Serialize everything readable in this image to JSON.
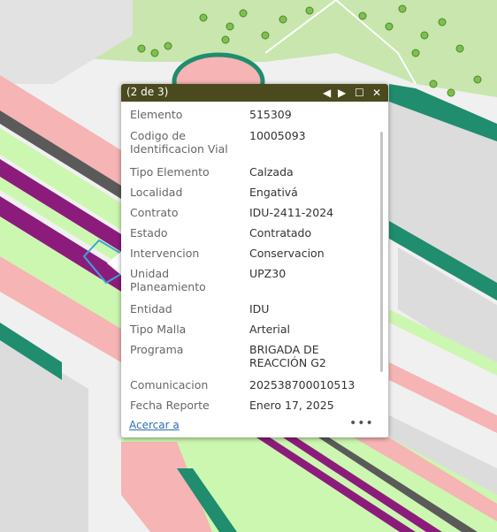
{
  "popup": {
    "title": "(2 de 3)",
    "prev_icon": "◀",
    "next_icon": "▶",
    "maximize_icon": "☐",
    "close_icon": "✕",
    "fields": [
      {
        "name": "Elemento",
        "value": "515309"
      },
      {
        "name": "Codigo de Identificacion Vial",
        "value": "10005093"
      },
      {
        "name": "Tipo Elemento",
        "value": "Calzada"
      },
      {
        "name": "Localidad",
        "value": "Engativá"
      },
      {
        "name": "Contrato",
        "value": "IDU-2411-2024"
      },
      {
        "name": "Estado",
        "value": "Contratado"
      },
      {
        "name": "Intervencion",
        "value": "Conservacion"
      },
      {
        "name": "Unidad Planeamiento",
        "value": "UPZ30"
      },
      {
        "name": "Entidad",
        "value": "IDU"
      },
      {
        "name": "Tipo Malla",
        "value": "Arterial"
      },
      {
        "name": "Programa",
        "value": "BRIGADA DE REACCIÓN G2"
      },
      {
        "name": "Comunicacion",
        "value": "202538700010513"
      },
      {
        "name": "Fecha Reporte",
        "value": "Enero 17, 2025"
      }
    ],
    "zoom_link": "Acercar a",
    "more": "•••"
  },
  "colors": {
    "header": "#4a4a1e",
    "park_green": "#c9e8b0",
    "road_green": "#ccf7b0",
    "road_purple": "#8c1c7c",
    "pink": "#f7b6b6",
    "teal": "#1f8d6e",
    "block_gray": "#dedede"
  }
}
